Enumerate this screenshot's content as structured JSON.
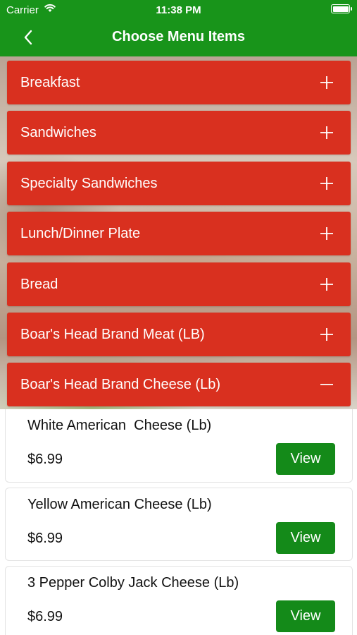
{
  "status_bar": {
    "carrier": "Carrier",
    "time": "11:38 PM"
  },
  "nav": {
    "title": "Choose Menu Items",
    "back_icon": "chevron-left-icon"
  },
  "categories": [
    {
      "label": "Breakfast",
      "expanded": false,
      "icon": "plus-icon"
    },
    {
      "label": "Sandwiches",
      "expanded": false,
      "icon": "plus-icon"
    },
    {
      "label": "Specialty Sandwiches",
      "expanded": false,
      "icon": "plus-icon"
    },
    {
      "label": "Lunch/Dinner Plate",
      "expanded": false,
      "icon": "plus-icon"
    },
    {
      "label": "Bread",
      "expanded": false,
      "icon": "plus-icon"
    },
    {
      "label": "Boar's Head Brand Meat (LB)",
      "expanded": false,
      "icon": "plus-icon"
    },
    {
      "label": "Boar's Head Brand Cheese (Lb)",
      "expanded": true,
      "icon": "minus-icon"
    }
  ],
  "items": [
    {
      "name": "White American  Cheese (Lb)",
      "price": "$6.99",
      "button": "View"
    },
    {
      "name": "Yellow American Cheese (Lb)",
      "price": "$6.99",
      "button": "View"
    },
    {
      "name": "3 Pepper Colby Jack Cheese (Lb)",
      "price": "$6.99",
      "button": "View"
    }
  ],
  "colors": {
    "header_green": "#18941a",
    "category_red": "#d9301f",
    "button_green": "#148a19"
  }
}
